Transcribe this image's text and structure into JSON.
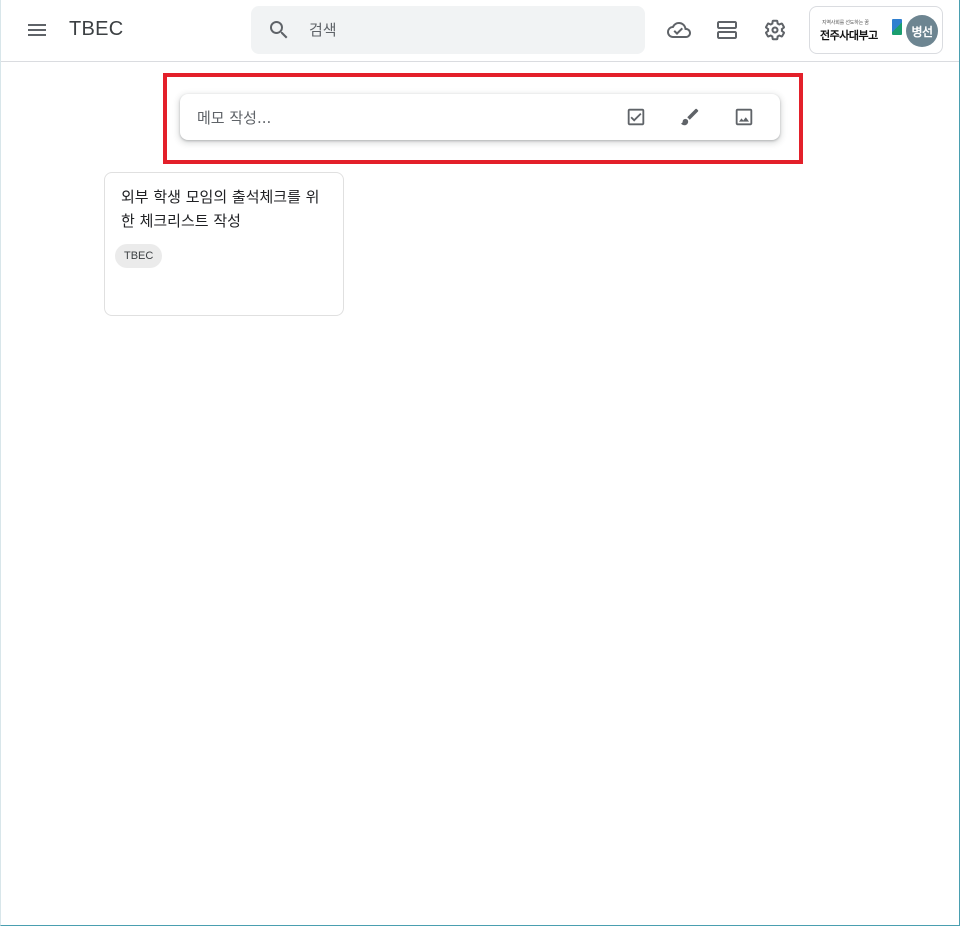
{
  "header": {
    "app_title": "TBEC",
    "search_placeholder": "검색",
    "icons": [
      "menu-icon",
      "search-icon",
      "cloud-done-icon",
      "list-view-icon",
      "settings-icon"
    ]
  },
  "account": {
    "org_tagline": "지역사회를 선도하는 꿈",
    "org_name": "전주사대부고",
    "avatar_text": "병선"
  },
  "take_note": {
    "placeholder": "메모 작성...",
    "icons": [
      "new-list-icon",
      "new-drawing-icon",
      "new-image-icon"
    ]
  },
  "notes": [
    {
      "title": "외부 학생 모임의 출석체크를 위한 체크리스트 작성",
      "label": "TBEC"
    }
  ],
  "colors": {
    "highlight": "#e3202a",
    "avatar_bg": "#6d8591",
    "search_bg": "#f1f3f4",
    "chip_bg": "#ebebeb"
  }
}
